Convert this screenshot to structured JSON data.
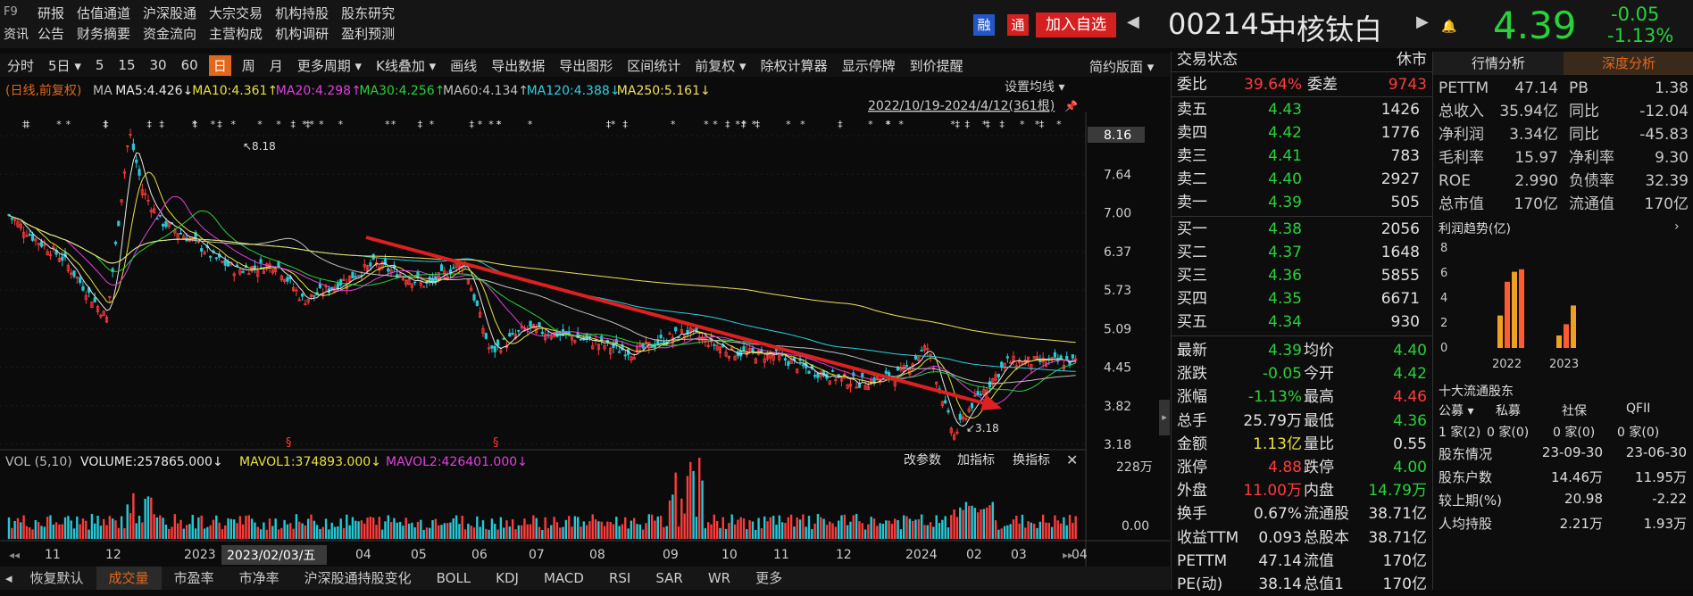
{
  "colors": {
    "up": "#ff3b3b",
    "down": "#29d13b",
    "accent": "#e1671c",
    "bg": "#0b0b0b"
  },
  "top": {
    "tag": "F9",
    "menu1": [
      "研报",
      "估值通道",
      "沪深股通",
      "大宗交易",
      "机构持股",
      "股东研究"
    ],
    "tag2": "资讯",
    "menu2": [
      "公告",
      "财务摘要",
      "资金流向",
      "主营构成",
      "机构调研",
      "盈利预测"
    ],
    "badge1": "融",
    "badge2": "通",
    "add": "加入自选",
    "code": "002145",
    "name": "中核钛白",
    "price": "4.39",
    "chg": "-0.05",
    "pct": "-1.13%"
  },
  "toolbar": [
    "分时",
    "5日",
    "5",
    "15",
    "30",
    "60",
    "日",
    "周",
    "月",
    "更多周期",
    "K线叠加",
    "画线",
    "导出数据",
    "导出图形",
    "区间统计",
    "前复权",
    "除权计算器",
    "显示停牌",
    "到价提醒"
  ],
  "toolbar_right": "简约版面",
  "ma_line": {
    "prefix": "(日线,前复权)",
    "items": [
      {
        "t": "MA",
        "c": "#bbbbbb"
      },
      {
        "t": "MA5:4.426↓",
        "c": "#e8e8e8"
      },
      {
        "t": "MA10:4.361↑",
        "c": "#e8e13a"
      },
      {
        "t": "MA20:4.298↑",
        "c": "#e040e0"
      },
      {
        "t": "MA30:4.256↑",
        "c": "#29d13b"
      },
      {
        "t": "MA60:4.134↑",
        "c": "#c0c0c0"
      },
      {
        "t": "MA120:4.388↓",
        "c": "#2ad0e0"
      },
      {
        "t": "MA250:5.161↓",
        "c": "#f0e060"
      }
    ]
  },
  "set_ma": "设置均线",
  "range": "2022/10/19-2024/4/12(361根)",
  "price_axis": [
    "8.16",
    "7.64",
    "7.00",
    "6.37",
    "5.73",
    "5.09",
    "4.45",
    "3.82",
    "3.18"
  ],
  "hi_label": "8.18",
  "lo_label": "3.18",
  "vol": {
    "label": "VOL (5,10)",
    "volume": "VOLUME:257865.000↓",
    "m1": "MAVOL1:374893.000↓",
    "m2": "MAVOL2:426401.000↓",
    "axis_top": "228万",
    "axis_bot": "0.00",
    "btns": [
      "改参数",
      "加指标",
      "换指标"
    ]
  },
  "x_axis": [
    "11",
    "12",
    "2023",
    "03",
    "04",
    "05",
    "06",
    "07",
    "08",
    "09",
    "10",
    "11",
    "12",
    "2024",
    "02",
    "03",
    "04"
  ],
  "cursor_date": "2023/02/03/五",
  "bottom_tabs": [
    "恢复默认",
    "成交量",
    "市盈率",
    "市净率",
    "沪深股通持股变化",
    "BOLL",
    "KDJ",
    "MACD",
    "RSI",
    "SAR",
    "WR",
    "更多"
  ],
  "trade": {
    "title": "交易状态",
    "status": "休市",
    "weibi_l": "委比",
    "weibi": "39.64%",
    "weicha_l": "委差",
    "weicha": "9743",
    "asks": [
      [
        "卖五",
        "4.43",
        "1426"
      ],
      [
        "卖四",
        "4.42",
        "1776"
      ],
      [
        "卖三",
        "4.41",
        "783"
      ],
      [
        "卖二",
        "4.40",
        "2927"
      ],
      [
        "卖一",
        "4.39",
        "505"
      ]
    ],
    "bids": [
      [
        "买一",
        "4.38",
        "2056"
      ],
      [
        "买二",
        "4.37",
        "1648"
      ],
      [
        "买三",
        "4.36",
        "5855"
      ],
      [
        "买四",
        "4.35",
        "6671"
      ],
      [
        "买五",
        "4.34",
        "930"
      ]
    ],
    "stats": [
      [
        "最新",
        "4.39",
        "g",
        "均价",
        "4.40",
        "g"
      ],
      [
        "涨跌",
        "-0.05",
        "g",
        "今开",
        "4.42",
        "g"
      ],
      [
        "涨幅",
        "-1.13%",
        "g",
        "最高",
        "4.46",
        "r"
      ],
      [
        "总手",
        "25.79万",
        "w",
        "最低",
        "4.36",
        "g"
      ],
      [
        "金额",
        "1.13亿",
        "y",
        "量比",
        "0.55",
        "w"
      ],
      [
        "涨停",
        "4.88",
        "r",
        "跌停",
        "4.00",
        "g"
      ],
      [
        "外盘",
        "11.00万",
        "r",
        "内盘",
        "14.79万",
        "g"
      ],
      [
        "换手",
        "0.67%",
        "w",
        "流通股",
        "38.71亿",
        "w"
      ],
      [
        "收益TTM",
        "0.093",
        "w",
        "总股本",
        "38.71亿",
        "w"
      ],
      [
        "PETTM",
        "47.14",
        "w",
        "流值",
        "170亿",
        "w"
      ],
      [
        "PE(动)",
        "38.14",
        "w",
        "总值1",
        "170亿",
        "w"
      ]
    ]
  },
  "fin": {
    "tab1": "行情分析",
    "tab2": "深度分析",
    "rows": [
      [
        "PETTM",
        "47.14",
        "PB",
        "1.38"
      ],
      [
        "总收入",
        "35.94亿",
        "同比",
        "-12.04"
      ],
      [
        "净利润",
        "3.34亿",
        "同比",
        "-45.83"
      ],
      [
        "毛利率",
        "15.97",
        "净利率",
        "9.30"
      ],
      [
        "ROE",
        "2.990",
        "负债率",
        "32.39"
      ],
      [
        "总市值",
        "170亿",
        "流通值",
        "170亿"
      ]
    ],
    "trend_title": "利润趋势(亿)",
    "trend_axis": [
      "8",
      "6",
      "4",
      "2",
      "0"
    ],
    "trend_years": [
      "2022",
      "2023"
    ],
    "trend_2022": [
      2.6,
      5.3,
      6.1,
      6.3
    ],
    "trend_2023": [
      1.0,
      1.9,
      3.4
    ],
    "holders_title": "十大流通股东",
    "holder_types": [
      "公募",
      "私募",
      "社保",
      "QFII"
    ],
    "holder_counts": [
      "1 家(2)",
      "0 家(0)",
      "0 家(0)",
      "0 家(0)"
    ],
    "holder_stats": [
      [
        "股东情况",
        "23-09-30",
        "23-06-30"
      ],
      [
        "股东户数",
        "14.46万",
        "11.95万"
      ],
      [
        "较上期(%)",
        "20.98",
        "-2.22"
      ],
      [
        "人均持股",
        "2.21万",
        "1.93万"
      ]
    ]
  }
}
